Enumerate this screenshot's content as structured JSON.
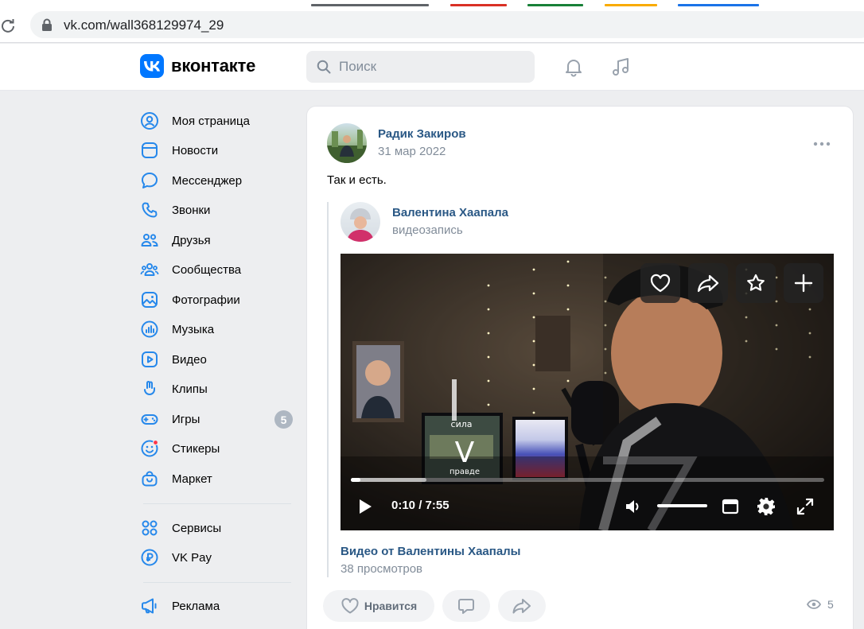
{
  "browser": {
    "url": "vk.com/wall368129974_29"
  },
  "header": {
    "logo_text": "вконтакте",
    "search_placeholder": "Поиск"
  },
  "nav": {
    "items": [
      {
        "label": "Моя страница",
        "icon": "user-circle-icon"
      },
      {
        "label": "Новости",
        "icon": "news-icon"
      },
      {
        "label": "Мессенджер",
        "icon": "message-icon"
      },
      {
        "label": "Звонки",
        "icon": "phone-icon"
      },
      {
        "label": "Друзья",
        "icon": "friends-icon"
      },
      {
        "label": "Сообщества",
        "icon": "communities-icon"
      },
      {
        "label": "Фотографии",
        "icon": "photo-icon"
      },
      {
        "label": "Музыка",
        "icon": "music-icon"
      },
      {
        "label": "Видео",
        "icon": "video-icon"
      },
      {
        "label": "Клипы",
        "icon": "clips-icon"
      },
      {
        "label": "Игры",
        "icon": "gamepad-icon",
        "badge": "5"
      },
      {
        "label": "Стикеры",
        "icon": "sticker-icon"
      },
      {
        "label": "Маркет",
        "icon": "market-icon"
      },
      {
        "label": "Сервисы",
        "icon": "services-icon"
      },
      {
        "label": "VK Pay",
        "icon": "vkpay-icon"
      },
      {
        "label": "Реклама",
        "icon": "megaphone-icon"
      }
    ]
  },
  "post": {
    "author": "Радик Закиров",
    "date": "31 мар 2022",
    "text": "Так и есть.",
    "repost": {
      "author": "Валентина Хаапала",
      "subtitle": "видеозапись",
      "video": {
        "overlay_text_top": "сила",
        "overlay_letter": "V",
        "overlay_text_bottom": "правде",
        "current_time": "0:10",
        "duration": "7:55",
        "progress": 0.021,
        "buffered": 0.16,
        "volume": 1.0
      },
      "video_title": "Видео от Валентины Хаапалы",
      "video_views": "38 просмотров"
    },
    "actions": {
      "like_label": "Нравится"
    },
    "views_count": "5"
  },
  "colors": {
    "vk_blue": "#0077ff",
    "link": "#2a5885",
    "secondary_text": "#818c99",
    "icon_blue": "#2688eb"
  }
}
